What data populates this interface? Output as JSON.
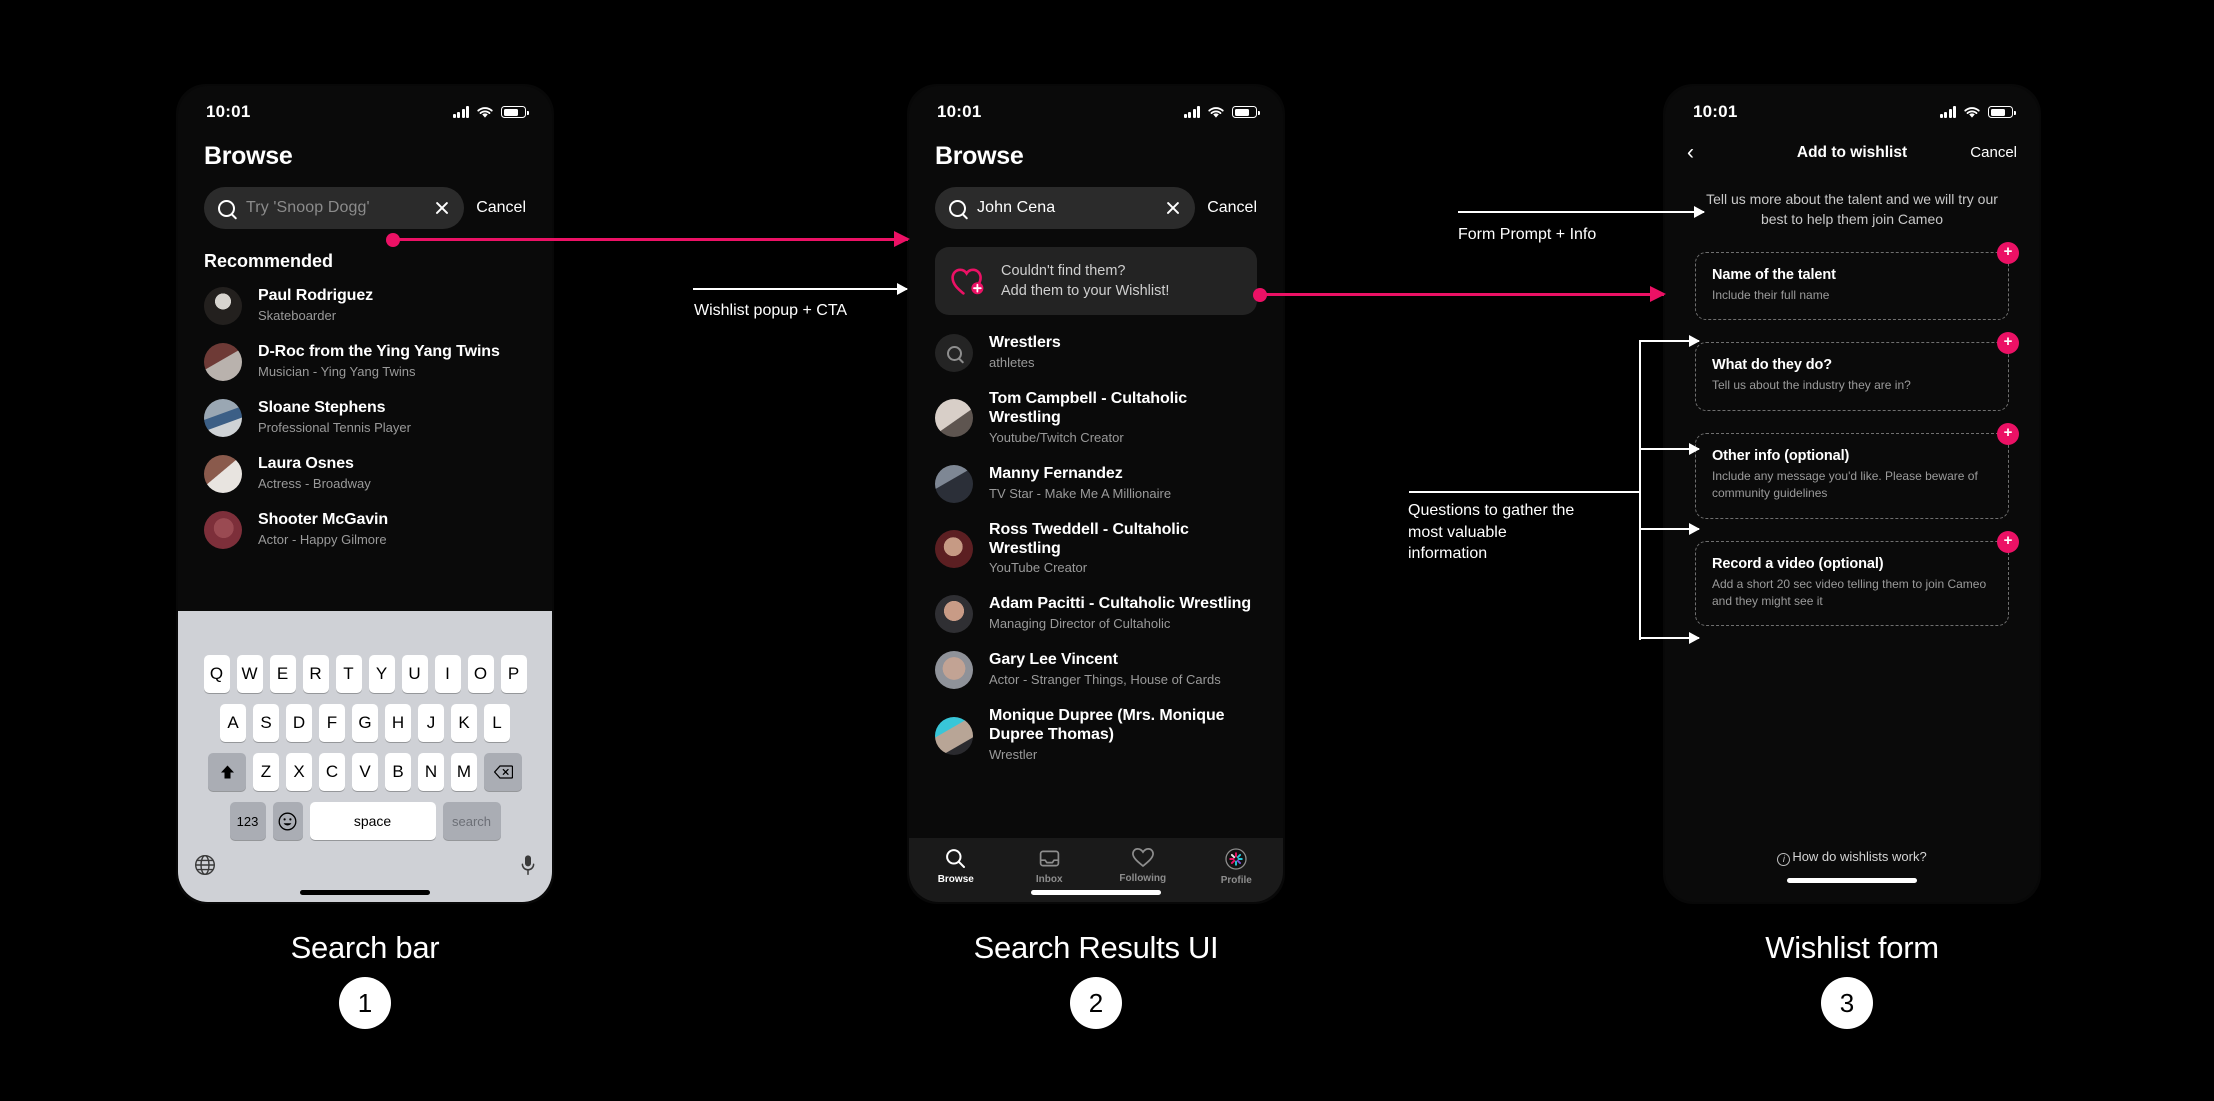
{
  "status_bar": {
    "time": "10:01",
    "signal_icon": "cellular-bars-icon",
    "wifi_icon": "wifi-icon",
    "battery_icon": "battery-icon"
  },
  "phone1": {
    "title": "Browse",
    "search": {
      "placeholder": "Try 'Snoop Dogg'",
      "value": "",
      "cancel_label": "Cancel",
      "search_icon": "search-icon",
      "clear_icon": "clear-icon"
    },
    "section_title": "Recommended",
    "people": [
      {
        "name": "Paul Rodriguez",
        "subtitle": "Skateboarder"
      },
      {
        "name": "D-Roc from the Ying Yang Twins",
        "subtitle": "Musician - Ying Yang Twins"
      },
      {
        "name": "Sloane Stephens",
        "subtitle": "Professional Tennis Player"
      },
      {
        "name": "Laura Osnes",
        "subtitle": "Actress - Broadway"
      },
      {
        "name": "Shooter McGavin",
        "subtitle": "Actor - Happy Gilmore"
      }
    ],
    "keyboard": {
      "row1": [
        "Q",
        "W",
        "E",
        "R",
        "T",
        "Y",
        "U",
        "I",
        "O",
        "P"
      ],
      "row2": [
        "A",
        "S",
        "D",
        "F",
        "G",
        "H",
        "J",
        "K",
        "L"
      ],
      "row3": [
        "Z",
        "X",
        "C",
        "V",
        "B",
        "N",
        "M"
      ],
      "shift_label": "⬆",
      "backspace_label": "⌫",
      "numbers_label": "123",
      "emoji_label": "☺",
      "space_label": "space",
      "search_label": "search",
      "globe_label": "🌐",
      "mic_label": "🎙"
    }
  },
  "phone2": {
    "title": "Browse",
    "search": {
      "value": "John Cena",
      "cancel_label": "Cancel",
      "search_icon": "search-icon",
      "clear_icon": "clear-icon"
    },
    "cta": {
      "icon": "heart-plus-icon",
      "line1": "Couldn't find them?",
      "line2": "Add them to your Wishlist!"
    },
    "results": [
      {
        "name": "Wrestlers",
        "subtitle": "athletes",
        "avatar_type": "search"
      },
      {
        "name": "Tom Campbell - Cultaholic Wrestling",
        "subtitle": "Youtube/Twitch Creator",
        "avatar_type": "photo"
      },
      {
        "name": "Manny Fernandez",
        "subtitle": "TV Star - Make Me A Millionaire",
        "avatar_type": "photo"
      },
      {
        "name": "Ross Tweddell - Cultaholic Wrestling",
        "subtitle": "YouTube Creator",
        "avatar_type": "photo"
      },
      {
        "name": "Adam Pacitti - Cultaholic Wrestling",
        "subtitle": "Managing Director of Cultaholic",
        "avatar_type": "photo"
      },
      {
        "name": "Gary Lee Vincent",
        "subtitle": "Actor - Stranger Things, House of Cards",
        "avatar_type": "photo"
      },
      {
        "name": "Monique Dupree (Mrs. Monique Dupree Thomas)",
        "subtitle": "Wrestler",
        "avatar_type": "photo"
      }
    ],
    "tabs": [
      {
        "label": "Browse",
        "icon": "search-icon",
        "active": true
      },
      {
        "label": "Inbox",
        "icon": "inbox-icon",
        "active": false
      },
      {
        "label": "Following",
        "icon": "heart-icon",
        "active": false
      },
      {
        "label": "Profile",
        "icon": "profile-avatar-icon",
        "active": false
      }
    ]
  },
  "phone3": {
    "nav": {
      "back_icon": "chevron-left-icon",
      "title": "Add to wishlist",
      "cancel_label": "Cancel"
    },
    "intro": "Tell us more about the talent and we will try our best to help them join Cameo",
    "fields": [
      {
        "title": "Name of the talent",
        "subtitle": "Include their full name",
        "add_label": "+"
      },
      {
        "title": "What do they do?",
        "subtitle": "Tell us about the industry they are in?",
        "add_label": "+"
      },
      {
        "title": "Other info (optional)",
        "subtitle": "Include any message you'd like. Please beware of community guidelines",
        "add_label": "+"
      },
      {
        "title": "Record a video (optional)",
        "subtitle": "Add a short 20 sec video telling them to join Cameo and they might see it",
        "add_label": "+"
      }
    ],
    "footer_link": {
      "icon": "info-icon",
      "label": "How do wishlists work?"
    }
  },
  "annotations": [
    {
      "id": "wishlist-popup-cta",
      "text": "Wishlist popup + CTA"
    },
    {
      "id": "form-prompt-info",
      "text": "Form Prompt + Info"
    },
    {
      "id": "questions-to-gather",
      "text": "Questions to gather the most valuable information"
    }
  ],
  "captions": [
    {
      "label": "Search bar",
      "number": "1"
    },
    {
      "label": "Search Results UI",
      "number": "2"
    },
    {
      "label": "Wishlist form",
      "number": "3"
    }
  ],
  "colors": {
    "accent": "#ec1165",
    "background": "#000000",
    "surface": "#1a1a1a",
    "pill": "#2b2b2b",
    "muted": "#9a9a9a"
  }
}
